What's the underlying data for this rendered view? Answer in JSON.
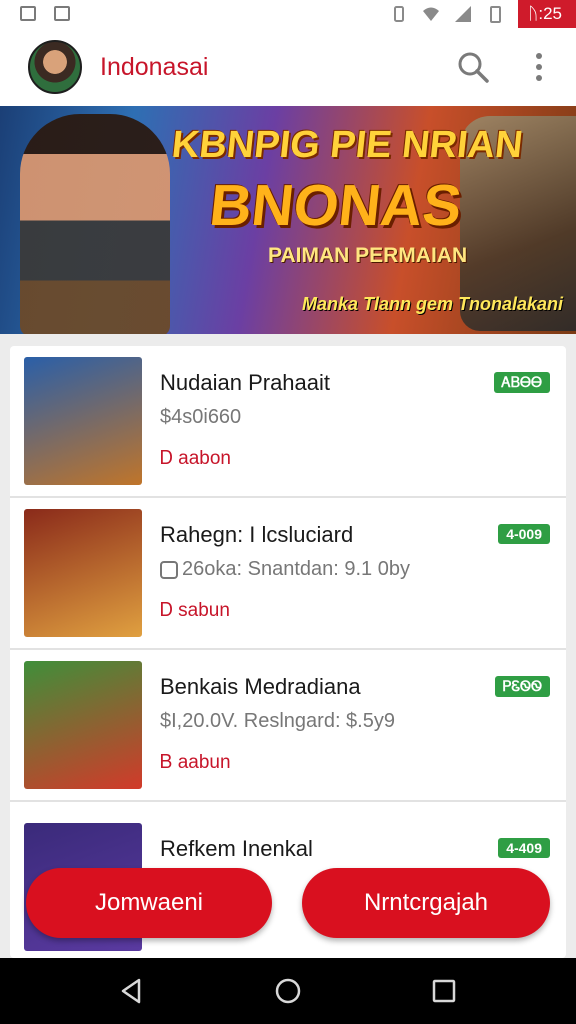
{
  "status_bar": {
    "time": "ᚢ:25"
  },
  "header": {
    "title": "Indonasai"
  },
  "banner": {
    "headline": "KBNPIG PIE NRIAN",
    "big_title": "BNONAS",
    "subtitle": "PAIMAN PERMAIAN",
    "tagline": "Manka Tlann gem Tnonalakani"
  },
  "games": [
    {
      "title": "Nudaian Prahaait",
      "subtitle": "$4s0i660",
      "meta": "Ꭰ aabon",
      "badge": "ᎪᏴᎾᎾ",
      "thumb_colors": [
        "#2a5fa8",
        "#c0752a"
      ]
    },
    {
      "title": "Rahegn: I lcsluciard",
      "subtitle": "26oka: Snantdan: 9.1 0by",
      "meta": "Ꭰ sabun",
      "badge": "4-009",
      "thumb_colors": [
        "#8a2a1a",
        "#e0a040"
      ]
    },
    {
      "title": "Benkais Medradiana",
      "subtitle": "$I,20.0V. Reslngard: $.5y9",
      "meta": "Ᏼ aabun",
      "badge": "ᏢᏋᏫᏫ",
      "thumb_colors": [
        "#3f8f3a",
        "#d23a2a"
      ]
    },
    {
      "title": "Refkem Inenkal",
      "subtitle": "",
      "meta": "",
      "badge": "4-409",
      "thumb_colors": [
        "#3a2a7a",
        "#5a3aa0"
      ]
    }
  ],
  "actions": {
    "left": "Jomwaeni",
    "right": "Nrntcrgajah"
  },
  "colors": {
    "accent": "#c7152a",
    "badge": "#2f9e44",
    "fab": "#d9101f"
  }
}
